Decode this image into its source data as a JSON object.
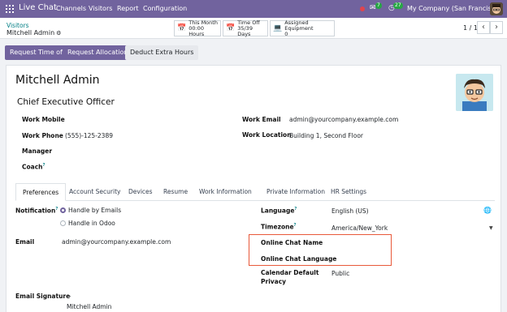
{
  "navbar": {
    "app_name": "Live Chat",
    "menu": [
      "Channels",
      "Visitors",
      "Report",
      "Configuration"
    ],
    "messages_count": "7",
    "activities_count": "27",
    "company": "My Company (San Francisco)"
  },
  "control": {
    "breadcrumb_parent": "Visitors",
    "breadcrumb_current": "Mitchell Admin",
    "smart_buttons": [
      {
        "line1": "This Month",
        "line2": "00:00 Hours"
      },
      {
        "line1": "Time Off",
        "line2": "35/39 Days"
      },
      {
        "line1": "Assigned Equipment",
        "line2": "0"
      }
    ],
    "pager": "1 / 1"
  },
  "status_buttons": {
    "request_time_off": "Request Time off",
    "request_allocation": "Request Allocation",
    "deduct_extra_hours": "Deduct Extra Hours"
  },
  "employee": {
    "name": "Mitchell Admin",
    "job_title": "Chief Executive Officer",
    "left_fields": [
      {
        "label": "Work Mobile",
        "value": ""
      },
      {
        "label": "Work Phone",
        "value": "(555)-125-2389"
      },
      {
        "label": "Manager",
        "value": ""
      },
      {
        "label": "Coach",
        "value": ""
      }
    ],
    "right_fields": [
      {
        "label": "Work Email",
        "value": "admin@yourcompany.example.com"
      },
      {
        "label": "Work Location",
        "value": "Building 1, Second Floor"
      }
    ]
  },
  "tabs": [
    "Preferences",
    "Account Security",
    "Devices",
    "Resume",
    "Work Information",
    "Private Information",
    "HR Settings"
  ],
  "preferences": {
    "notification_label": "Notification",
    "notification_options": [
      "Handle by Emails",
      "Handle in Odoo"
    ],
    "email_label": "Email",
    "email_value": "admin@yourcompany.example.com",
    "signature_label": "Email Signature",
    "signature_line1": "--",
    "signature_line2": "Mitchell Admin",
    "language_label": "Language",
    "language_value": "English (US)",
    "timezone_label": "Timezone",
    "timezone_value": "America/New_York",
    "chat_name_label": "Online Chat Name",
    "chat_language_label": "Online Chat Language",
    "calendar_label_line1": "Calendar Default",
    "calendar_label_line2": "Privacy",
    "calendar_value": "Public"
  },
  "colors": {
    "brand": "#71639e",
    "link": "#017e84",
    "highlight": "#e8593a",
    "badge": "#28a745"
  },
  "icons": [
    "apps-grid-icon",
    "red-dot-icon",
    "chat-bubble-icon",
    "clock-icon",
    "gear-icon",
    "calendar-icon",
    "laptop-icon",
    "globe-icon",
    "chevron-left-icon",
    "chevron-right-icon"
  ]
}
